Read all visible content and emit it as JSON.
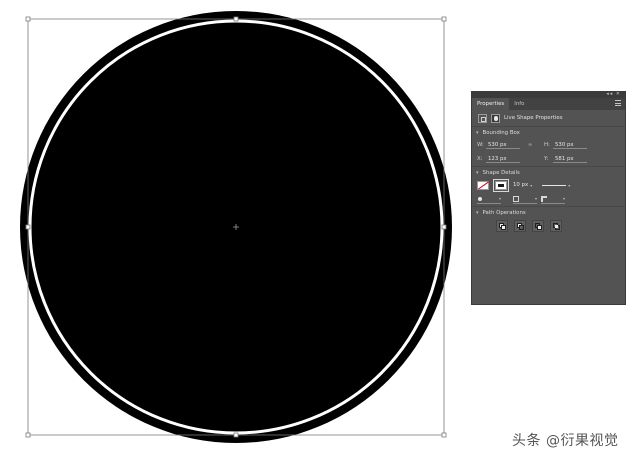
{
  "canvas": {
    "shape": "circle",
    "fill_color": "#000000",
    "ring_color": "#ffffff",
    "bbox_color": "#7a7a7a"
  },
  "properties_panel": {
    "tabs": [
      {
        "label": "Properties",
        "active": true
      },
      {
        "label": "Info",
        "active": false
      }
    ],
    "header_title": "Live Shape Properties",
    "bounding_box": {
      "title": "Bounding Box",
      "w_label": "W:",
      "w_value": "530 px",
      "h_label": "H:",
      "h_value": "530 px",
      "x_label": "X:",
      "x_value": "123 px",
      "y_label": "Y:",
      "y_value": "581 px",
      "link_icon": "link-icon"
    },
    "shape_details": {
      "title": "Shape Details",
      "stroke_width": "10 px",
      "fill_color": "none",
      "stroke_color": "#000000"
    },
    "path_operations": {
      "title": "Path Operations",
      "buttons": [
        "unite-icon",
        "subtract-icon",
        "intersect-icon",
        "exclude-icon"
      ]
    }
  },
  "watermark": {
    "text": "头条 @衍果视觉"
  }
}
